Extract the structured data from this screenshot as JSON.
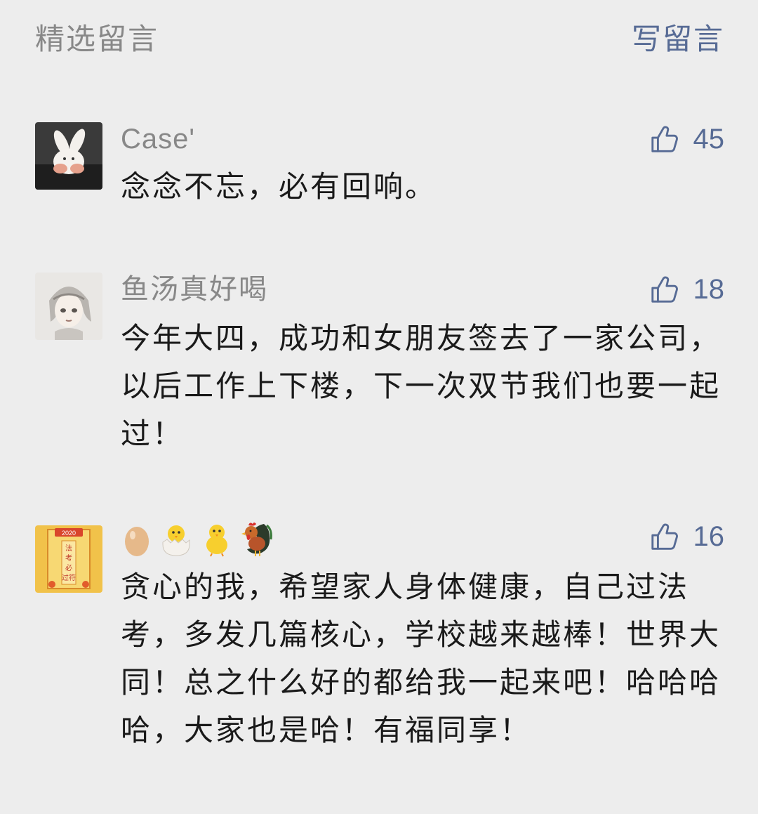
{
  "header": {
    "title": "精选留言",
    "write_label": "写留言"
  },
  "comments": [
    {
      "nickname": "Case'",
      "likes": "45",
      "content": "念念不忘，必有回响。",
      "avatar_icon": "white-rabbit-plush-icon"
    },
    {
      "nickname": "鱼汤真好喝",
      "likes": "18",
      "content": "今年大四，成功和女朋友签去了一家公司，以后工作上下楼，下一次双节我们也要一起过！",
      "avatar_icon": "anime-girl-sketch-icon"
    },
    {
      "nickname_emojis": [
        "egg-emoji",
        "hatching-chick-emoji",
        "baby-chick-emoji",
        "rooster-emoji"
      ],
      "likes": "16",
      "content": "贪心的我，希望家人身体健康，自己过法考，多发几篇核心，学校越来越棒！世界大同！总之什么好的都给我一起来吧！哈哈哈哈，大家也是哈！有福同享！",
      "avatar_icon": "lucky-charm-card-icon",
      "avatar_text": [
        "2020",
        "法考必过符"
      ]
    }
  ],
  "colors": {
    "background": "#ededed",
    "link": "#576b95",
    "meta": "#888888",
    "text": "#1a1a1a"
  }
}
